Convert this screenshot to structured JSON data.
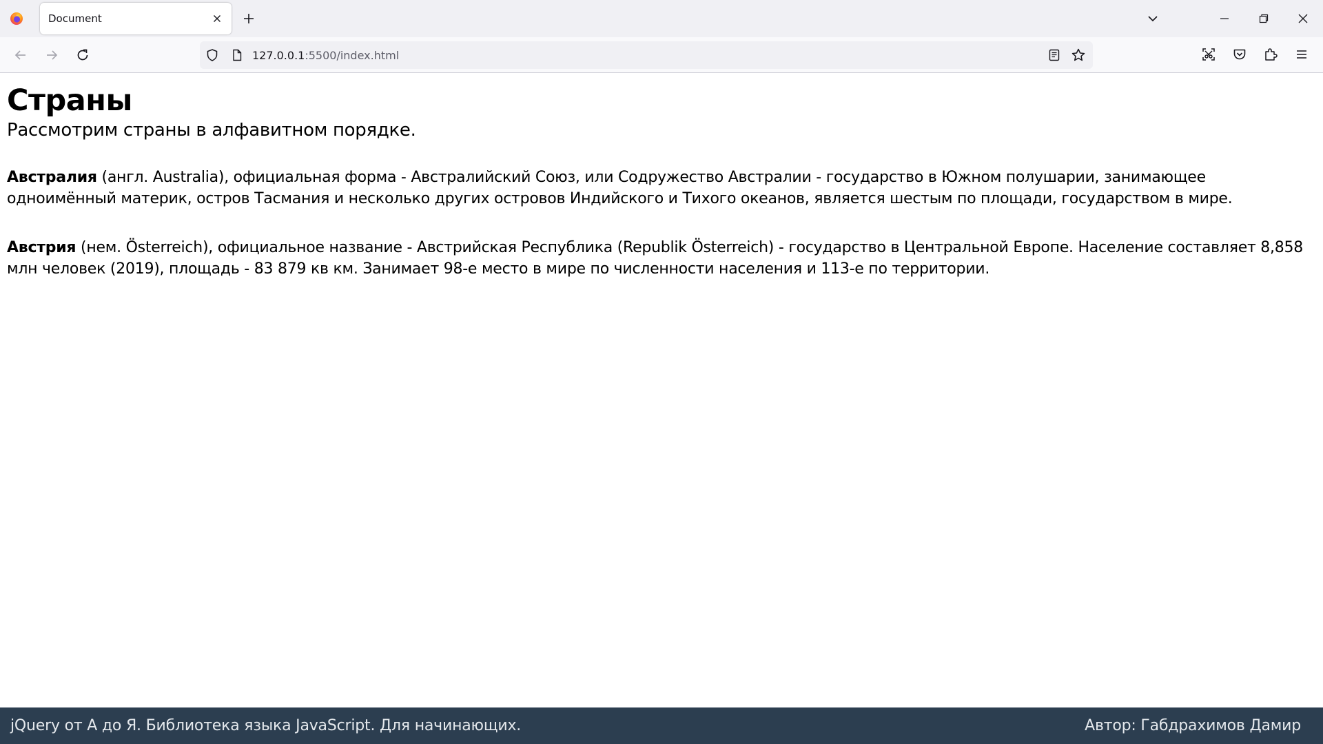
{
  "browser": {
    "tab": {
      "title": "Document"
    },
    "url": {
      "host": "127.0.0.1",
      "path": ":5500/index.html"
    },
    "icons": {
      "firefox": "firefox-logo-icon",
      "close_tab": "close-icon",
      "new_tab": "plus-icon",
      "list_tabs": "chevron-down-icon",
      "back": "arrow-left-icon",
      "forward": "arrow-right-icon",
      "reload": "reload-icon",
      "shield": "shield-icon",
      "page": "page-icon",
      "reader": "reader-view-icon",
      "bookmark": "star-icon",
      "screenshot": "screenshot-icon",
      "pocket": "pocket-icon",
      "extensions": "puzzle-icon",
      "menu": "hamburger-menu-icon"
    }
  },
  "page": {
    "title": "Страны",
    "subtitle": "Рассмотрим страны в алфавитном порядке.",
    "countries": [
      {
        "name": "Австралия",
        "text": " (англ. Australia), официальная форма - Австралийский Союз, или Содружество Австралии - государство в Южном полушарии, занимающее одноимённый материк, остров Тасмания и несколько других островов Индийского и Тихого океанов, является шестым по площади, государством в мире."
      },
      {
        "name": "Австрия",
        "text": " (нем. Österreich), официальное название - Австрийская Республика (Republik Österreich) - государство в Центральной Европе. Население составляет 8,858 млн человек (2019), площадь - 83 879 кв км. Занимает 98-е место в мире по численности населения и 113-е по территории."
      }
    ]
  },
  "footer": {
    "left": "jQuery от А до Я. Библиотека языка JavaScript. Для начинающих.",
    "right": "Автор: Габдрахимов Дамир"
  },
  "colors": {
    "footer_bg": "#2c3e50",
    "tabstrip_bg": "#f0f0f4"
  }
}
